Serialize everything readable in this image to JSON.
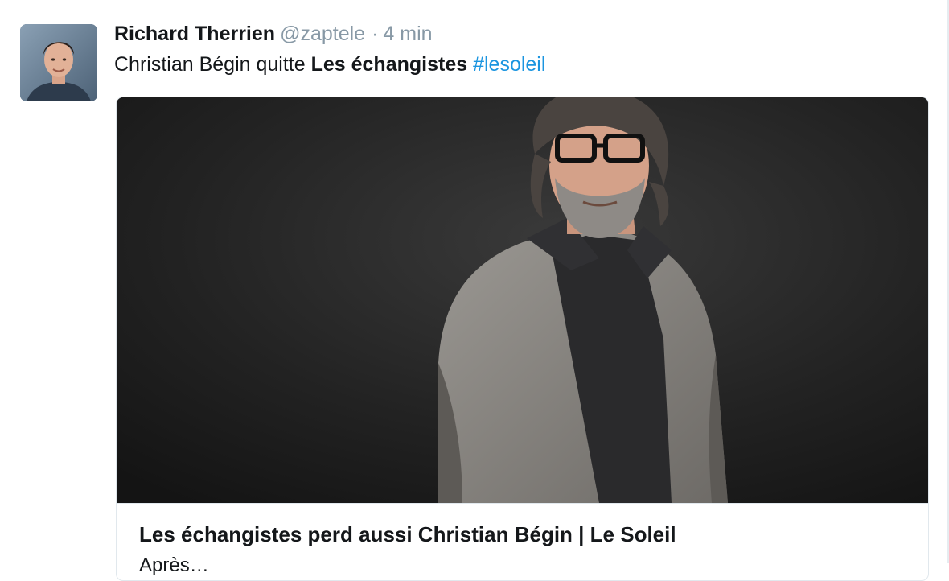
{
  "tweet": {
    "author_name": "Richard Therrien",
    "author_handle": "@zaptele",
    "separator": "·",
    "time": "4 min",
    "text_plain": "Christian Bégin quitte ",
    "text_bold": "Les échangistes",
    "text_space": " ",
    "hashtag": "#lesoleil"
  },
  "card": {
    "title": "Les échangistes perd aussi Christian Bégin | Le Soleil",
    "description": "Après…"
  },
  "colors": {
    "hashtag": "#1b95e0",
    "muted": "#8899a6",
    "text": "#14171a",
    "border": "#e1e8ed"
  },
  "icons": {
    "avatar": "profile-photo",
    "card_image": "portrait-photo"
  }
}
